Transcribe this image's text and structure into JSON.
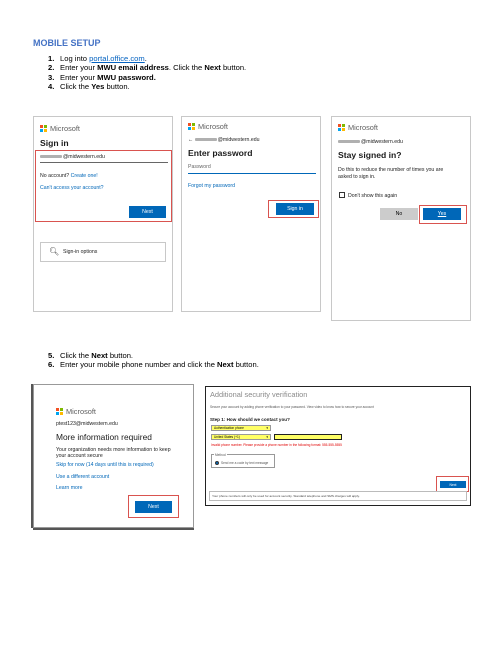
{
  "heading": "MOBILE SETUP",
  "steps_first": [
    {
      "num": "1.",
      "pre": "Log into ",
      "link": "portal.office.com",
      "post": "."
    },
    {
      "num": "2.",
      "pre": "Enter your ",
      "bold1": "MWU email address",
      "mid": ". Click the ",
      "bold2": "Next",
      "post": " button."
    },
    {
      "num": "3.",
      "pre": "Enter your ",
      "bold1": "MWU password."
    },
    {
      "num": "4.",
      "pre": "Click the ",
      "bold1": "Yes",
      "post": " button."
    }
  ],
  "steps_second": [
    {
      "num": "5.",
      "pre": "Click the ",
      "bold1": "Next",
      "post": " button."
    },
    {
      "num": "6.",
      "pre": "Enter your mobile phone number and click the ",
      "bold1": "Next",
      "post": " button."
    }
  ],
  "brand": "Microsoft",
  "signin_card": {
    "title": "Sign in",
    "email_suffix": "@midwestern.edu",
    "no_account": "No account?",
    "create_one": "Create one!",
    "cant_access": "Can't access your account?",
    "next": "Next",
    "signin_options": "Sign-in options"
  },
  "password_card": {
    "back_arrow": "←",
    "email_suffix": "@midwestern.edu",
    "title": "Enter password",
    "placeholder": "Password",
    "forgot": "Forgot my password",
    "signin": "Sign in"
  },
  "stay_card": {
    "email_suffix": "@midwestern.edu",
    "title": "Stay signed in?",
    "body_line1": "Do this to reduce the number of times you are",
    "body_line2": "asked to sign in.",
    "dont_show": "Don't show this again",
    "no": "No",
    "yes": "Yes"
  },
  "more_info_card": {
    "email": "ptest123@midwestern.edu",
    "title": "More information required",
    "body_line1": "Your organization needs more information to keep",
    "body_line2": "your account secure",
    "skip": "Skip for now (14 days until this is required)",
    "use_different": "Use a different account",
    "learn_more": "Learn more",
    "next": "Next"
  },
  "security_card": {
    "title": "Additional security verification",
    "subtitle": "Secure your account by adding phone verification to your password. View video to know how to secure your account",
    "step": "Step 1: How should we contact you?",
    "auth_method": "Authentication phone",
    "country": "United States (+1)",
    "error": "Invalid phone number. Please provide a phone number in the following format: 555-555-5555",
    "method_label": "Method",
    "method_option": "Send me a code by text message",
    "next": "Next",
    "footer": "Your phone numbers will only be used for account security. Standard telephone and SMS charges will apply."
  },
  "icons": {
    "key_icon": "search-key",
    "dropdown_icon": "chevron-down"
  },
  "colors": {
    "heading": "#4472c4",
    "link": "#0563c1",
    "ms_blue": "#0067b8",
    "highlight_red": "#d9534f",
    "yellow": "#ffff66"
  }
}
